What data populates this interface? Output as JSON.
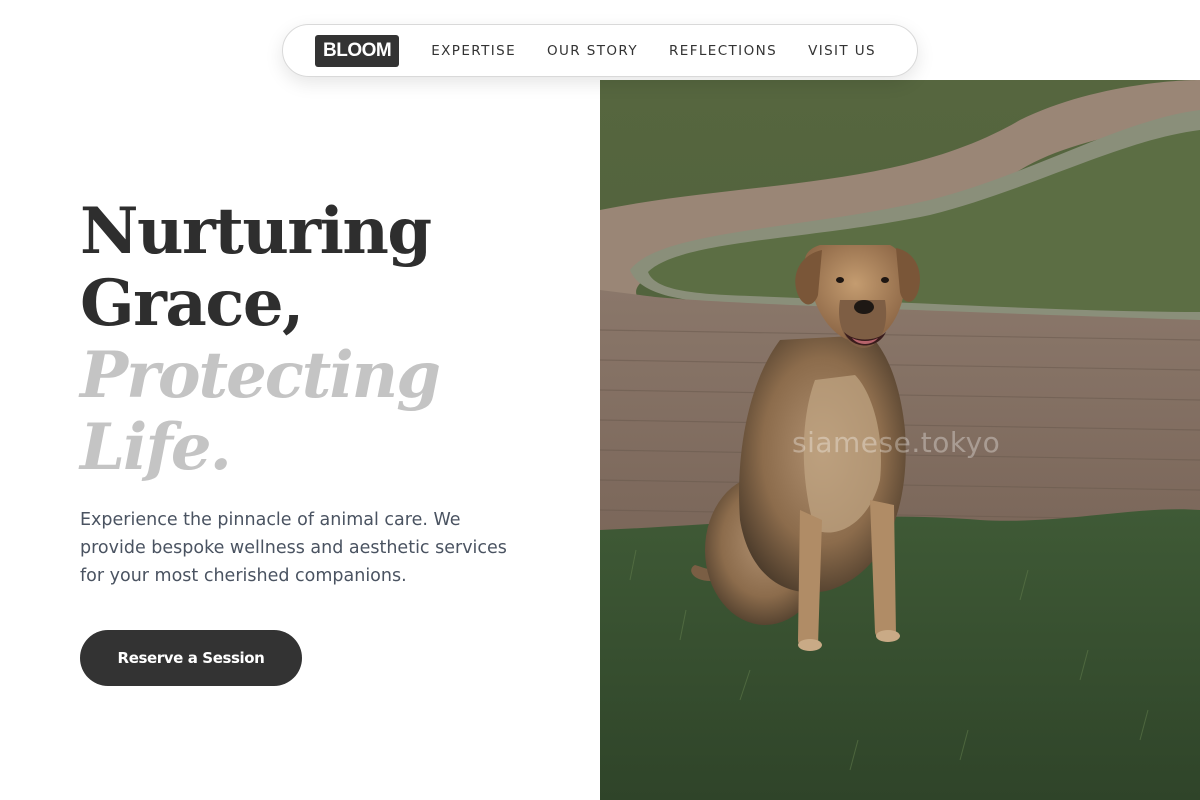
{
  "nav": {
    "brand": "BLOOM",
    "links": [
      "EXPERTISE",
      "OUR STORY",
      "REFLECTIONS",
      "VISIT US"
    ]
  },
  "hero": {
    "headline_line1": "Nurturing",
    "headline_line2": "Grace,",
    "headline_italic_line1": "Protecting",
    "headline_italic_line2": "Life.",
    "subtitle": "Experience the pinnacle of animal care. We provide bespoke wellness and aesthetic services for your most cherished companions.",
    "cta_label": "Reserve a Session"
  },
  "photo": {
    "watermark": "siamese.tokyo",
    "alt": "dog sitting on grass"
  },
  "colors": {
    "text_dark": "#2e2e2e",
    "text_italic": "#c4c4c4",
    "subtitle": "#4a5361",
    "button_bg": "#333333"
  }
}
